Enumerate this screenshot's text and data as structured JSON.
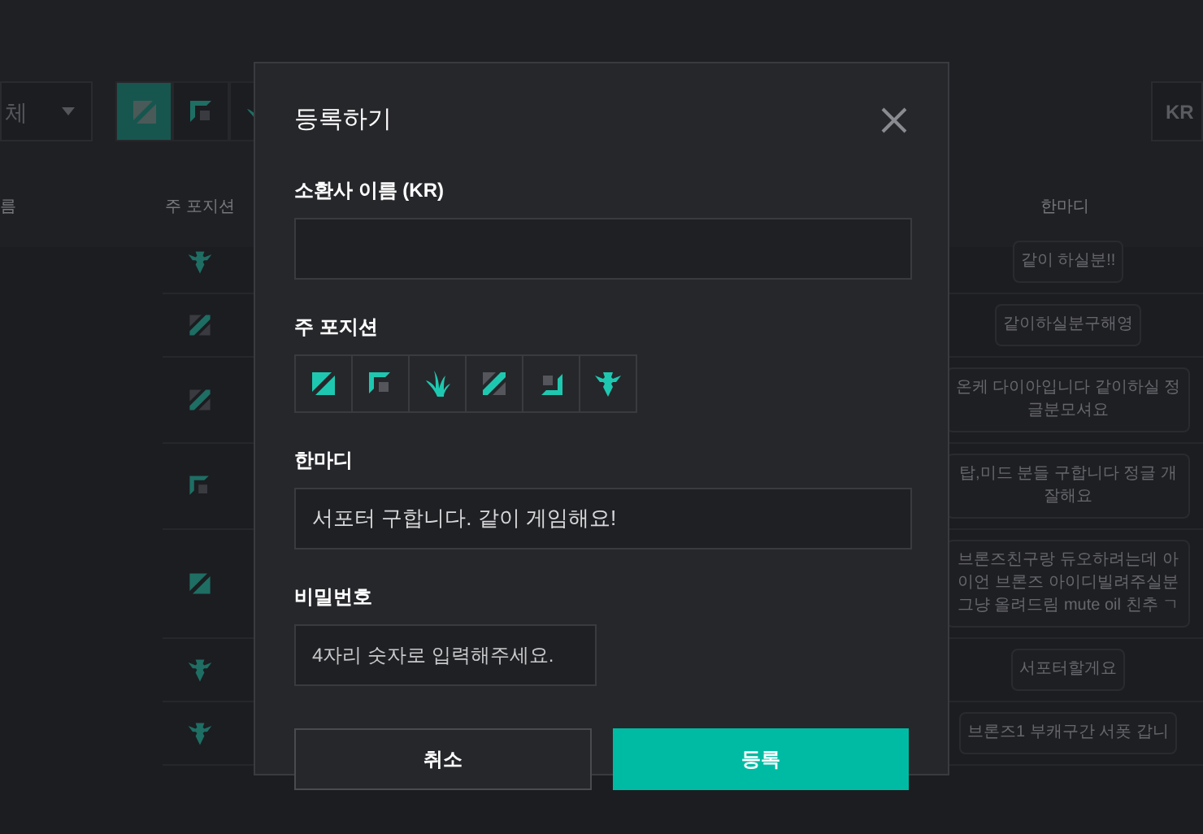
{
  "background": {
    "filter": {
      "dropdown": "체",
      "positions": [
        {
          "kind": "all",
          "selected": true
        },
        {
          "kind": "top",
          "selected": false
        },
        {
          "kind": "jungle",
          "selected": false
        }
      ]
    },
    "region": "KR",
    "table": {
      "columns": [
        "름",
        "주 포지션",
        "한마디"
      ],
      "rows": [
        {
          "kind": "support",
          "comment": "같이 하실분!!"
        },
        {
          "kind": "mid",
          "comment": "같이하실분구해영"
        },
        {
          "kind": "mid",
          "comment": "온케 다이아입니다 같이하실 정글분모셔요"
        },
        {
          "kind": "top",
          "comment": "탑,미드 분들 구합니다 정글 개잘해요"
        },
        {
          "kind": "all",
          "comment": "브론즈친구랑 듀오하려는데 아이언 브론즈 아이디빌려주실분 그냥 올려드림 mute oil 친추 ㄱ"
        },
        {
          "kind": "support",
          "comment": "서포터할게요"
        },
        {
          "kind": "support",
          "comment": "브론즈1 부캐구간 서폿 갑니"
        }
      ]
    }
  },
  "dialog": {
    "title": "등록하기",
    "fields": [
      {
        "kind": "text",
        "label": "소환사 이름 (KR)"
      },
      {
        "kind": "positions",
        "label": "주 포지션",
        "options": [
          {
            "kind": "all"
          },
          {
            "kind": "top"
          },
          {
            "kind": "jungle"
          },
          {
            "kind": "mid"
          },
          {
            "kind": "bottom"
          },
          {
            "kind": "support"
          }
        ]
      },
      {
        "kind": "text",
        "label": "한마디",
        "value": "서포터 구합니다. 같이 게임해요!"
      },
      {
        "kind": "password",
        "label": "비밀번호",
        "placeholder": "4자리 숫자로 입력해주세요."
      }
    ],
    "buttons": [
      {
        "kind": "secondary",
        "label": "취소"
      },
      {
        "kind": "primary",
        "label": "등록"
      }
    ]
  }
}
